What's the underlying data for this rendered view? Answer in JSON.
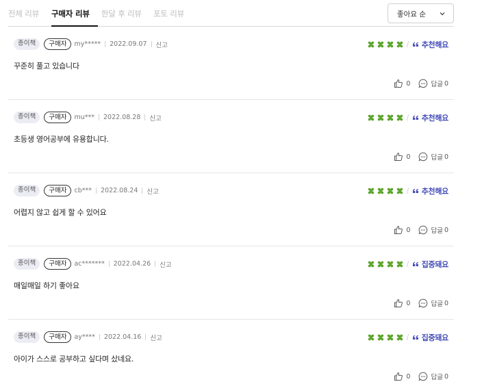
{
  "tabs": [
    {
      "label": "전체 리뷰",
      "active": false
    },
    {
      "label": "구매자 리뷰",
      "active": true
    },
    {
      "label": "한달 후 리뷰",
      "active": false
    },
    {
      "label": "포토 리뷰",
      "active": false
    }
  ],
  "sort": {
    "label": "좋아요 순",
    "icon": "chevron-down-icon"
  },
  "colors": {
    "clover": "#5ca52c",
    "accent": "#444cb8",
    "text": "#222222",
    "muted": "#777777"
  },
  "reviews": [
    {
      "type": "종이책",
      "badge": "구매자",
      "user": "my*****",
      "date": "2022.09.07",
      "report": "신고",
      "rating_label": "추천해요",
      "clovers": 4,
      "content": "꾸준히 풀고 있습니다",
      "likes": "0",
      "reply_label": "답글",
      "replies": "0"
    },
    {
      "type": "종이책",
      "badge": "구매자",
      "user": "mu***",
      "date": "2022.08.28",
      "report": "신고",
      "rating_label": "추천해요",
      "clovers": 4,
      "content": "초등생 영어공부에 유용합니다.",
      "likes": "0",
      "reply_label": "답글",
      "replies": "0"
    },
    {
      "type": "종이책",
      "badge": "구매자",
      "user": "cb***",
      "date": "2022.08.24",
      "report": "신고",
      "rating_label": "추천해요",
      "clovers": 4,
      "content": "어렵지 않고 쉽게 할 수 있어요",
      "likes": "0",
      "reply_label": "답글",
      "replies": "0"
    },
    {
      "type": "종이책",
      "badge": "구매자",
      "user": "ac*******",
      "date": "2022.04.26",
      "report": "신고",
      "rating_label": "집중돼요",
      "clovers": 4,
      "content": "매일매일 하기 좋아요",
      "likes": "0",
      "reply_label": "답글",
      "replies": "0"
    },
    {
      "type": "종이책",
      "badge": "구매자",
      "user": "ay****",
      "date": "2022.04.16",
      "report": "신고",
      "rating_label": "집중돼요",
      "clovers": 4,
      "content": "아이가 스스로 공부하고 싶다며 샀네요.",
      "likes": "0",
      "reply_label": "답글",
      "replies": "0"
    }
  ]
}
